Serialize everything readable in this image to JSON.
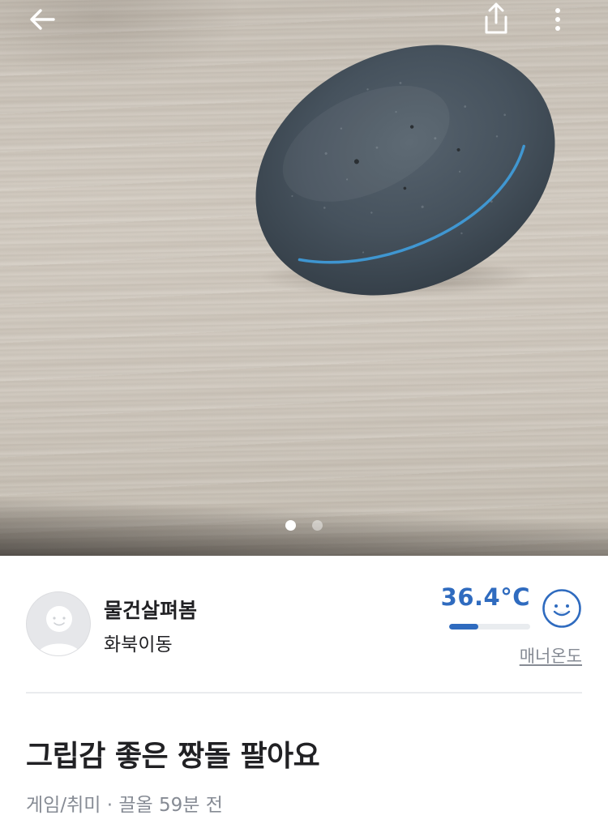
{
  "header": {
    "back_icon": "back-arrow-icon",
    "share_icon": "share-icon",
    "more_icon": "more-vertical-icon"
  },
  "image_carousel": {
    "current_page": 1,
    "total_pages": 2
  },
  "seller": {
    "nickname": "물건살펴봄",
    "region": "화북이동",
    "manner_temperature": "36.4°C",
    "temperature_level": 0.364,
    "manner_label": "매너온도",
    "face_icon": "smile-face-icon"
  },
  "product": {
    "title": "그립감 좋은 짱돌 팔아요",
    "category": "게임/취미",
    "separator": " · ",
    "time_posted": "끌올 59분 전"
  },
  "colors": {
    "accent": "#2f6bbf",
    "muted_text": "#868b94",
    "primary_text": "#212124"
  }
}
